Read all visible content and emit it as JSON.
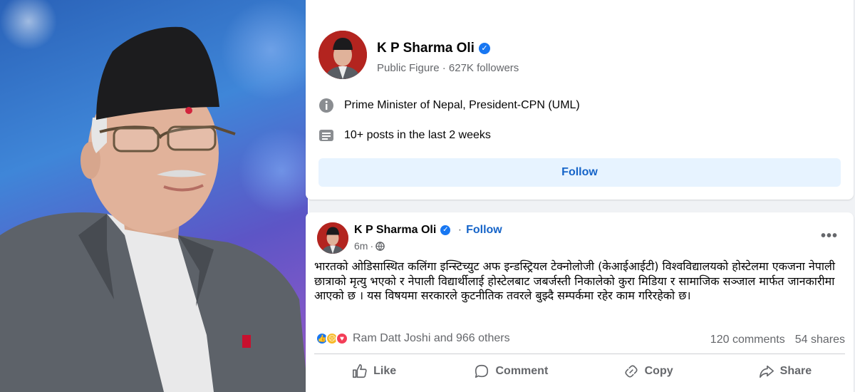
{
  "page": {
    "name": "K P Sharma Oli",
    "category": "Public Figure",
    "followers": "627K followers",
    "separator": " · ",
    "intro": "Prime Minister of Nepal, President-CPN (UML)",
    "activity": "10+ posts in the last 2 weeks",
    "follow_label": "Follow"
  },
  "post": {
    "author": "K P Sharma Oli",
    "follow_label": "Follow",
    "follow_sep": "·",
    "time": "6m",
    "more_label": "•••",
    "text": "भारतको ओडिसास्थित कलिंगा इन्स्टिच्युट अफ इन्डस्ट्रियल टेक्नोलोजी (केआईआईटी) विश्वविद्यालयको होस्टेलमा एकजना नेपाली छात्राको मृत्यु भएको र नेपाली विद्यार्थीलाई होस्टेलबाट जबर्जस्ती निकालेको कुरा मिडिया र सामाजिक सञ्जाल मार्फत जानकारीमा आएको छ । यस विषयमा सरकारले कुटनीतिक तवरले बुझ्दै सम्पर्कमा रहेर काम गरिरहेको छ।",
    "reactions_text": "Ram Datt Joshi and 966 others",
    "comments": "120 comments",
    "shares": "54 shares",
    "actions": {
      "like": "Like",
      "comment": "Comment",
      "copy": "Copy",
      "share": "Share"
    }
  },
  "colors": {
    "accent": "#1877f2",
    "follow_text": "#1664c8",
    "follow_bg": "#e7f3ff",
    "secondary_text": "#65676b"
  },
  "icons": [
    "verified-badge-icon",
    "info-icon",
    "posts-icon",
    "globe-icon",
    "like-icon",
    "comment-icon",
    "copy-icon",
    "share-icon",
    "more-icon"
  ]
}
